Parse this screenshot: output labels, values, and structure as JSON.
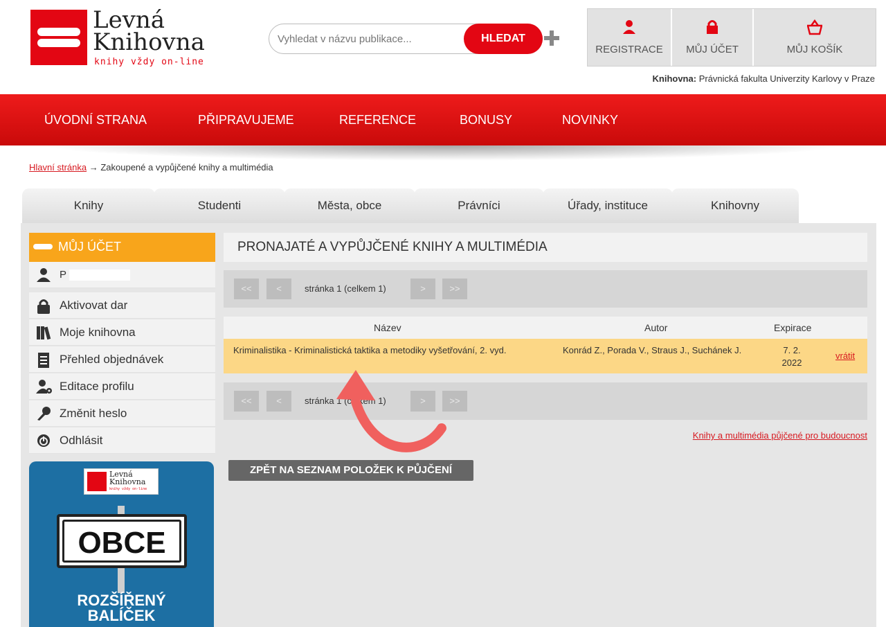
{
  "logo": {
    "line1": "Levná",
    "line2": "Knihovna",
    "tagline": "knihy vždy on-line"
  },
  "search": {
    "placeholder": "Vyhledat v názvu publikace...",
    "button": "HLEDAT"
  },
  "account_bar": {
    "register": "REGISTRACE",
    "my_account": "MŮJ ÚČET",
    "my_cart": "MŮJ KOŠÍK"
  },
  "library": {
    "label": "Knihovna:",
    "name": "Právnická fakulta Univerzity Karlovy v Praze"
  },
  "nav": [
    "ÚVODNÍ STRANA",
    "PŘIPRAVUJEME",
    "REFERENCE",
    "BONUSY",
    "NOVINKY"
  ],
  "breadcrumb": {
    "home": "Hlavní stránka",
    "separator": "→",
    "current": "Zakoupené a vypůjčené knihy a multimédia"
  },
  "tabs": [
    "Knihy",
    "Studenti",
    "Města, obce",
    "Právníci",
    "Úřady, instituce",
    "Knihovny"
  ],
  "sidebar": {
    "title": "MŮJ ÚČET",
    "user": "P",
    "items": [
      "Aktivovat dar",
      "Moje knihovna",
      "Přehled objednávek",
      "Editace profilu",
      "Změnit heslo",
      "Odhlásit"
    ]
  },
  "promo": {
    "logo_line1": "Levná",
    "logo_line2": "Knihovna",
    "logo_tagline": "knihy vždy on-line",
    "sign": "OBCE",
    "line1": "ROZŠÍŘENÝ",
    "line2": "BALÍČEK"
  },
  "content": {
    "title": "PRONAJATÉ A VYPŮJČENÉ KNIHY A MULTIMÉDIA",
    "pager": {
      "first": "<<",
      "prev": "<",
      "text": "stránka 1 (celkem 1)",
      "next": ">",
      "last": ">>"
    },
    "table": {
      "headers": [
        "Název",
        "Autor",
        "Expirace"
      ],
      "rows": [
        {
          "title": "Kriminalistika - Kriminalistická taktika a metodiky vyšetřování, 2. vyd.",
          "author": "Konrád Z., Porada V., Straus J., Suchánek J.",
          "expiry": "7. 2. 2022",
          "action": "vrátit"
        }
      ]
    },
    "future_link": "Knihy a multimédia půjčené pro budoucnost",
    "back_button": "ZPĚT NA SEZNAM POLOŽEK K PŮJČENÍ"
  },
  "colors": {
    "brand_red": "#e30613",
    "sidebar_orange": "#f8a51b",
    "highlight_row": "#fcd786",
    "annotation_arrow": "#f0605e"
  }
}
